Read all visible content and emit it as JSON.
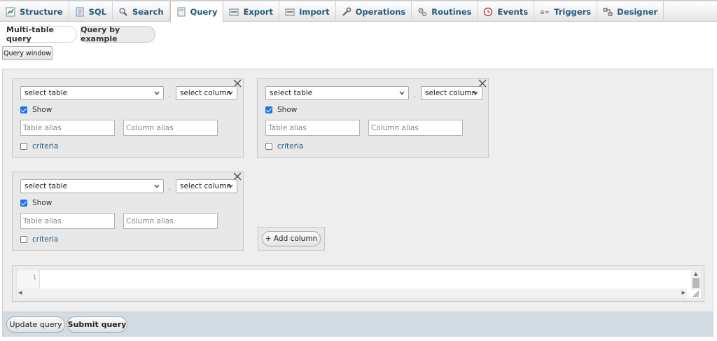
{
  "tabs": [
    {
      "label": "Structure",
      "icon": "structure-icon"
    },
    {
      "label": "SQL",
      "icon": "sql-icon"
    },
    {
      "label": "Search",
      "icon": "search-icon"
    },
    {
      "label": "Query",
      "icon": "query-icon",
      "active": true
    },
    {
      "label": "Export",
      "icon": "export-icon"
    },
    {
      "label": "Import",
      "icon": "import-icon"
    },
    {
      "label": "Operations",
      "icon": "wrench-icon"
    },
    {
      "label": "Routines",
      "icon": "routines-icon"
    },
    {
      "label": "Events",
      "icon": "clock-icon"
    },
    {
      "label": "Triggers",
      "icon": "triggers-icon"
    },
    {
      "label": "Designer",
      "icon": "designer-icon"
    }
  ],
  "subtabs": {
    "multi_table": "Multi-table query",
    "by_example": "Query by example"
  },
  "query_window_button": "Query window",
  "columns": [
    {
      "table_select": "select table",
      "column_select": "select column",
      "show_checked": true,
      "show_label": "Show",
      "table_alias_placeholder": "Table alias",
      "column_alias_placeholder": "Column alias",
      "criteria_checked": false,
      "criteria_label": "criteria"
    },
    {
      "table_select": "select table",
      "column_select": "select column",
      "show_checked": true,
      "show_label": "Show",
      "table_alias_placeholder": "Table alias",
      "column_alias_placeholder": "Column alias",
      "criteria_checked": false,
      "criteria_label": "criteria"
    },
    {
      "table_select": "select table",
      "column_select": "select column",
      "show_checked": true,
      "show_label": "Show",
      "table_alias_placeholder": "Table alias",
      "column_alias_placeholder": "Column alias",
      "criteria_checked": false,
      "criteria_label": "criteria"
    }
  ],
  "dot_separator": ".",
  "add_column_button": "+ Add column",
  "editor": {
    "line_number": "1"
  },
  "footer": {
    "update_button": "Update query",
    "submit_button": "Submit query"
  },
  "colors": {
    "link_blue": "#235a81",
    "checkbox_blue": "#1a73e8",
    "footer_bg": "#d3dce3",
    "panel_bg": "#eeeeee"
  }
}
